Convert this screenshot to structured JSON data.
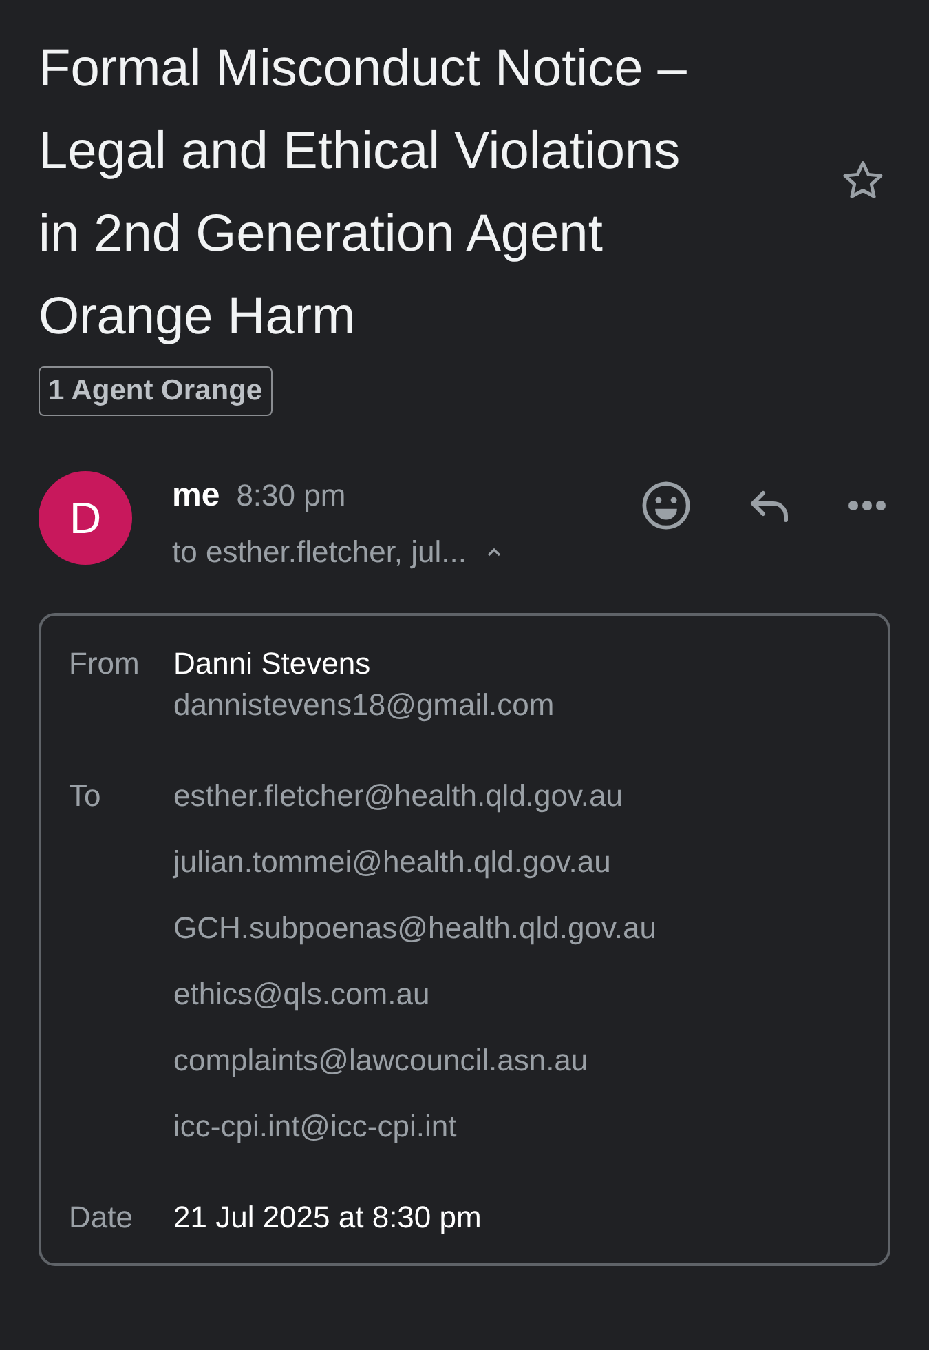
{
  "subject": "Formal Misconduct Notice – Legal and Ethical Violations in 2nd Generation Agent Orange Harm",
  "label": "1 Agent Orange",
  "starred": false,
  "message": {
    "avatar_letter": "D",
    "color": "#c8185c",
    "sender": "me",
    "time": "8:30 pm",
    "recipients_summary": "to esther.fletcher, jul...",
    "details_expanded": true
  },
  "details": {
    "from_label": "From",
    "from_name": "Danni Stevens",
    "from_email": "dannistevens18@gmail.com",
    "to_label": "To",
    "to": [
      "esther.fletcher@health.qld.gov.au",
      "julian.tommei@health.qld.gov.au",
      "GCH.subpoenas@health.qld.gov.au",
      "ethics@qls.com.au",
      "complaints@lawcouncil.asn.au",
      "icc-cpi.int@icc-cpi.int"
    ],
    "date_label": "Date",
    "date": "21 Jul 2025 at 8:30 pm"
  }
}
